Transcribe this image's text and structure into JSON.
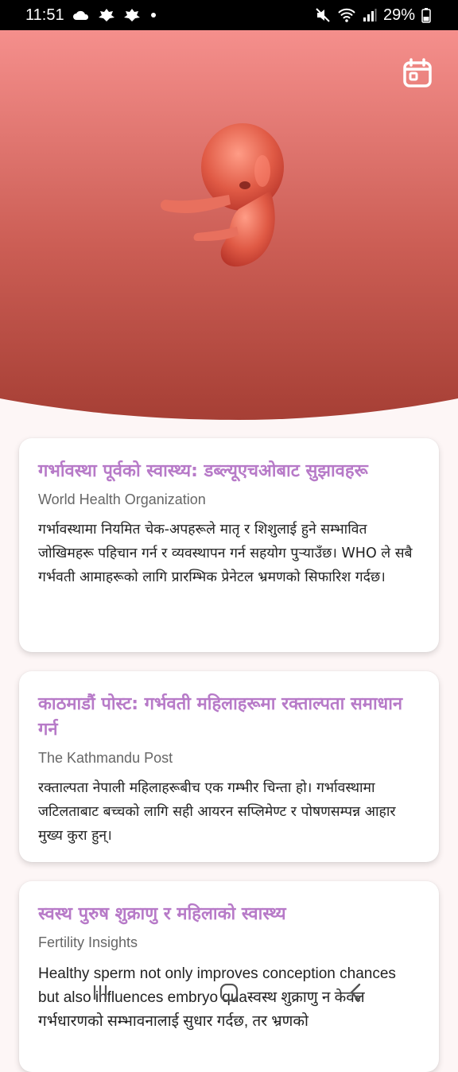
{
  "status_bar": {
    "time": "11:51",
    "battery": "29%",
    "left_icons": [
      "cloud-icon",
      "leaf-icon",
      "leaf-icon",
      "dot-icon"
    ],
    "right_icons": [
      "mute-icon",
      "wifi-icon",
      "signal-icon",
      "battery-icon"
    ]
  },
  "header": {
    "calendar_icon": "calendar-icon",
    "gradient": [
      "#f58f8c",
      "#a63f35"
    ]
  },
  "cards": [
    {
      "title": "गर्भावस्था पूर्वको स्वास्थ्य: डब्ल्यूएचओबाट सुझावहरू",
      "source": "World Health Organization",
      "body": "गर्भावस्थामा नियमित चेक-अपहरूले मातृ र शिशुलाई हुने सम्भावित जोखिमहरू पहिचान गर्न र व्यवस्थापन गर्न सहयोग पुऱ्याउँछ। WHO ले सबै गर्भवती आमाहरूको लागि प्रारम्भिक प्रेनेटल भ्रमणको सिफारिश गर्दछ।"
    },
    {
      "title": "काठमाडौं पोस्ट: गर्भवती महिलाहरूमा रक्ताल्पता समाधान गर्न",
      "source": "The Kathmandu Post",
      "body": "रक्ताल्पता नेपाली महिलाहरूबीच एक गम्भीर चिन्ता हो। गर्भावस्थामा जटिलताबाट बच्चको लागि सही आयरन सप्लिमेण्ट र पोषणसम्पन्न आहार मुख्य कुरा हुन्।"
    },
    {
      "title": "स्वस्थ पुरुष शुक्राणु र महिलाको स्वास्थ्य",
      "source": "Fertility Insights",
      "body": "Healthy sperm not only improves conception chances but also influences embryo quaस्वस्थ शुक्राणु न केवल गर्भधारणको सम्भावनालाई सुधार गर्दछ, तर भ्रणको"
    }
  ],
  "colors": {
    "title": "#b77ac8",
    "page_bg": "#fdf6f6",
    "card_bg": "#ffffff"
  },
  "nav_bar": {
    "icons": [
      "recents-icon",
      "home-icon",
      "back-icon"
    ]
  }
}
